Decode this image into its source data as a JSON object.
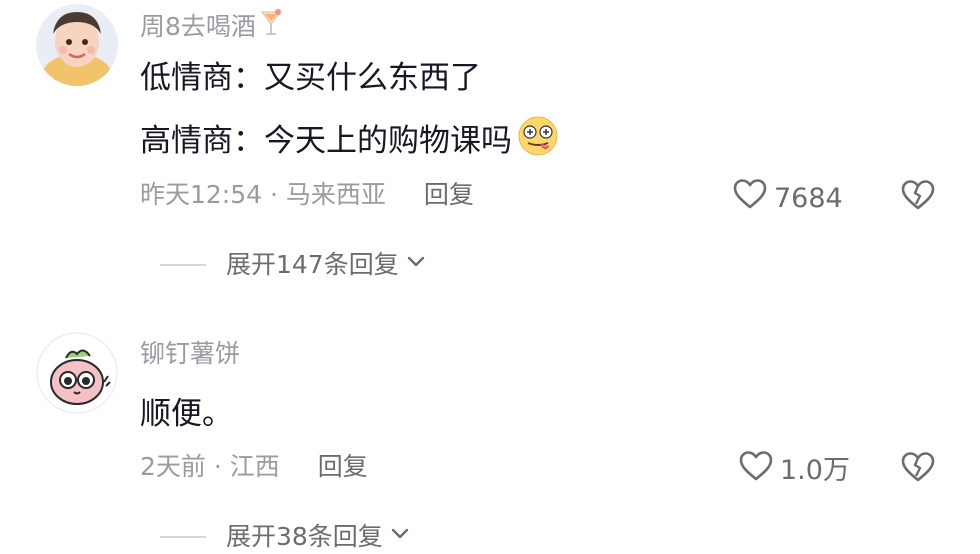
{
  "comments": [
    {
      "username": "周8去喝酒",
      "username_icon": "cocktail-icon",
      "lines": [
        "低情商：又买什么东西了",
        "高情商：今天上的购物课吗"
      ],
      "line2_emoji": "silly-face-emoji",
      "time": "昨天12:54",
      "separator": " · ",
      "location": "马来西亚",
      "reply_label": "回复",
      "likes": "7684",
      "expand_label": "展开147条回复"
    },
    {
      "username": "铆钉薯饼",
      "lines": [
        "顺便。"
      ],
      "time": "2天前",
      "separator": " · ",
      "location": "江西",
      "reply_label": "回复",
      "likes": "1.0万",
      "expand_label": "展开38条回复"
    }
  ],
  "colors": {
    "text": "#161823",
    "secondary": "#9a9ba1",
    "action": "#6b6c72"
  }
}
